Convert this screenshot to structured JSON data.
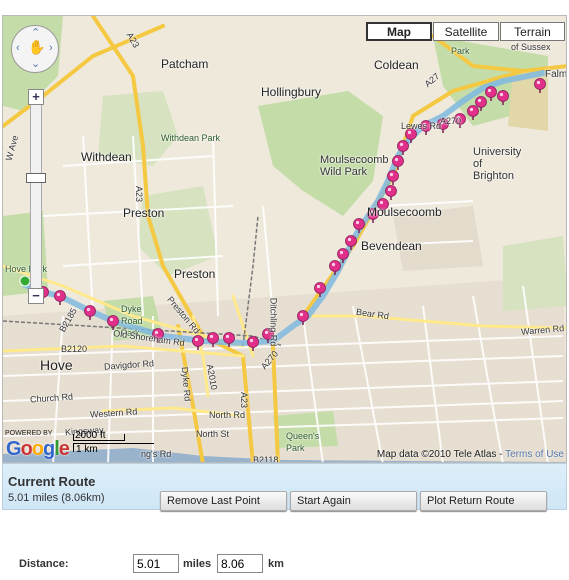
{
  "map": {
    "type_buttons": [
      {
        "label": "Map",
        "active": true
      },
      {
        "label": "Satellite",
        "active": false
      },
      {
        "label": "Terrain",
        "active": false
      }
    ],
    "places": {
      "patcham": "Patcham",
      "hollingbury": "Hollingbury",
      "coldean": "Coldean",
      "withdean": "Withdean",
      "withdean_park": "Withdean Park",
      "moulsecoomb_wild_park": "Moulsecoomb Wild Park",
      "university": "University of Brighton",
      "preston": "Preston",
      "moulsecoomb": "Moulsecoomb",
      "bevendean": "Bevendean",
      "preston2": "Preston",
      "hove_park": "Hove Park",
      "dyke_road_park": "Dyke Road Park",
      "hove": "Hove",
      "queens_park": "Queen's Park",
      "stanmer_park": "Park",
      "univ_sussex": "of Sussex",
      "falmer": "Falme"
    },
    "roads": {
      "a23_north": "A23",
      "a23_mid": "A23",
      "a27": "A27",
      "a270": "A270",
      "a270_b": "A270",
      "a2010": "A2010",
      "a23_south": "A23",
      "b2185": "B2185",
      "b2120": "B2120",
      "b2118": "B2118",
      "lewes_rd": "Lewes Rd",
      "old_shoreham": "Old Shoreham Rd",
      "preston_rd": "Preston Rd",
      "ditchling_rd": "Ditchling Rd",
      "bear_rd": "Bear Rd",
      "warren_rd": "Warren Rd",
      "davigdor_rd": "Davigdor Rd",
      "church_rd": "Church Rd",
      "western_rd": "Western Rd",
      "north_rd": "North Rd",
      "north_st": "North St",
      "dyke_rd": "Dyke Rd",
      "kingsway": "Kingsway",
      "kings_rd": "ng's Rd",
      "w_ave": "W Ave"
    },
    "scale": {
      "feet": "2000 ft",
      "km": "1 km"
    },
    "attribution": "Map data ©2010 Tele Atlas - ",
    "terms_link": "Terms of Use",
    "logo": "Google",
    "powered_by": "POWERED BY"
  },
  "route": {
    "title": "Current Route",
    "summary": "5.01 miles (8.06km)",
    "buttons": {
      "remove": "Remove Last Point",
      "start_again": "Start Again",
      "plot_return": "Plot Return Route"
    }
  },
  "distance": {
    "label": "Distance:",
    "miles_value": "5.01",
    "miles_unit": "miles",
    "km_value": "8.06",
    "km_unit": "km"
  },
  "colors": {
    "route": "#7fb9e0",
    "marker": "#e0308a",
    "park": "#c4dca8",
    "road_major": "#f5c842",
    "road_minor": "#ffffff",
    "land": "#efe9dc",
    "sea": "#99b3cc",
    "urban": "#e8e0d0"
  }
}
